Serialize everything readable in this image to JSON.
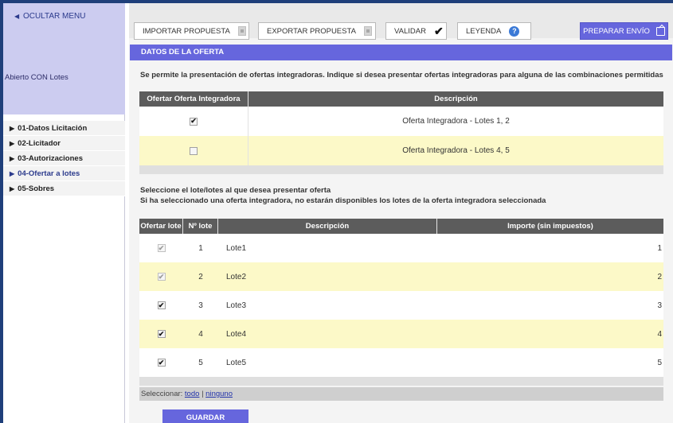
{
  "sidebar": {
    "hide_menu_label": "OCULTAR MENU",
    "procedure_label": "Abierto CON Lotes",
    "items": [
      {
        "label": "01-Datos Licitación",
        "active": false
      },
      {
        "label": "02-Licitador",
        "active": false
      },
      {
        "label": "03-Autorizaciones",
        "active": false
      },
      {
        "label": "04-Ofertar a lotes",
        "active": true
      },
      {
        "label": "05-Sobres",
        "active": false
      }
    ]
  },
  "toolbar": {
    "import_label": "IMPORTAR PROPUESTA",
    "export_label": "EXPORTAR PROPUESTA",
    "validate_label": "VALIDAR",
    "legend_label": "LEYENDA",
    "send_label": "PREPARAR ENVÍO"
  },
  "section": {
    "title": "DATOS DE LA OFERTA",
    "intro": "Se permite la presentación de ofertas integradoras. Indique si desea presentar ofertas integradoras para alguna de las combinaciones permitidas"
  },
  "integrated_table": {
    "headers": [
      "Ofertar Oferta Integradora",
      "Descripción"
    ],
    "rows": [
      {
        "checked": true,
        "description": "Oferta Integradora - Lotes 1, 2"
      },
      {
        "checked": false,
        "description": "Oferta Integradora - Lotes 4, 5"
      }
    ]
  },
  "lots_intro": {
    "line1": "Seleccione el lote/lotes al que desea presentar oferta",
    "line2": "Si ha seleccionado una oferta integradora, no estarán disponibles los lotes de la oferta integradora seleccionada"
  },
  "lots_table": {
    "headers": [
      "Ofertar lote",
      "Nº lote",
      "Descripción",
      "Importe (sin impuestos)"
    ],
    "rows": [
      {
        "checked": true,
        "disabled": true,
        "number": "1",
        "description": "Lote1",
        "amount": "1"
      },
      {
        "checked": true,
        "disabled": true,
        "number": "2",
        "description": "Lote2",
        "amount": "2"
      },
      {
        "checked": true,
        "disabled": false,
        "number": "3",
        "description": "Lote3",
        "amount": "3"
      },
      {
        "checked": true,
        "disabled": false,
        "number": "4",
        "description": "Lote4",
        "amount": "4"
      },
      {
        "checked": true,
        "disabled": false,
        "number": "5",
        "description": "Lote5",
        "amount": "5"
      }
    ]
  },
  "select_bar": {
    "prefix": "Seleccionar:",
    "all_label": "todo",
    "separator": "|",
    "none_label": "ninguno"
  },
  "save_label": "GUARDAR",
  "colors": {
    "accent": "#6666dd",
    "sidebar_top": "#ccccf0",
    "alt_row": "#fcf9c8",
    "table_header": "#5c5c5c"
  }
}
